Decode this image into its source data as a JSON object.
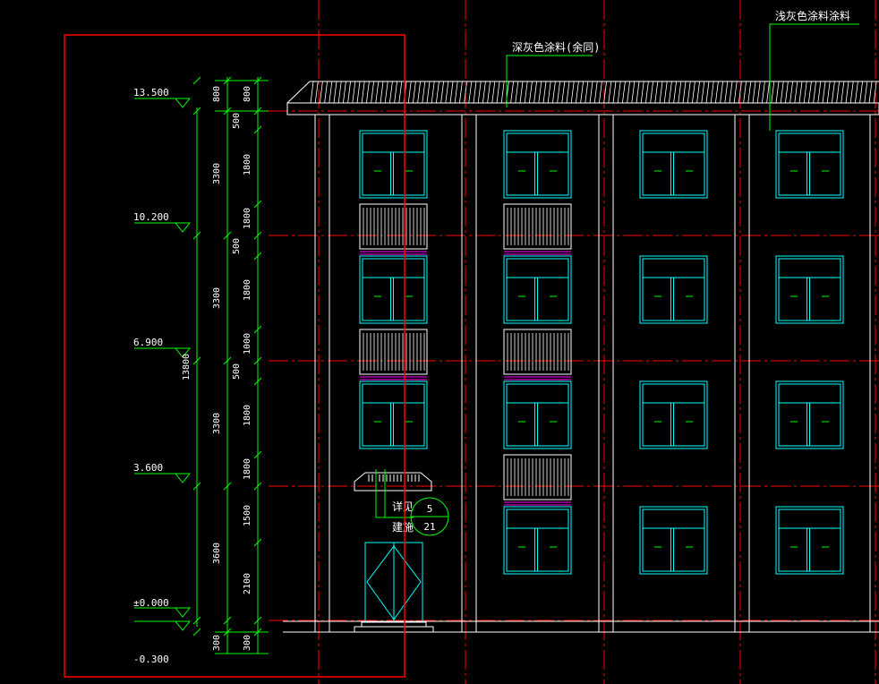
{
  "colors": {
    "background": "#000000",
    "outline": "#ffffff",
    "window": "#00ffff",
    "dimension": "#00ff00",
    "axis_red": "#ff0000",
    "railing": "#ff00ff",
    "annotation": "#ffffff"
  },
  "annotations": {
    "dark_grey": "深灰色涂料(余同)",
    "light_grey": "浅灰色涂料涂料",
    "detail_ref_line1": "详见",
    "detail_ref_line2": "建施",
    "detail_num_top": "5",
    "detail_num_bottom": "21"
  },
  "elevations": [
    {
      "label": "13.500"
    },
    {
      "label": "10.200"
    },
    {
      "label": "6.900"
    },
    {
      "label": "3.600"
    },
    {
      "label": "±0.000"
    },
    {
      "label": "-0.300"
    }
  ],
  "dims_outer": [
    "3300",
    "3300",
    "3300",
    "3600"
  ],
  "dims_total": "13800",
  "dims_top": [
    "800",
    "800"
  ],
  "dims_bottom": [
    "300",
    "300"
  ],
  "dims_inner": [
    "500",
    "1800",
    "1800",
    "500",
    "1800",
    "1000",
    "500",
    "1800",
    "1800",
    "1500",
    "2100"
  ]
}
